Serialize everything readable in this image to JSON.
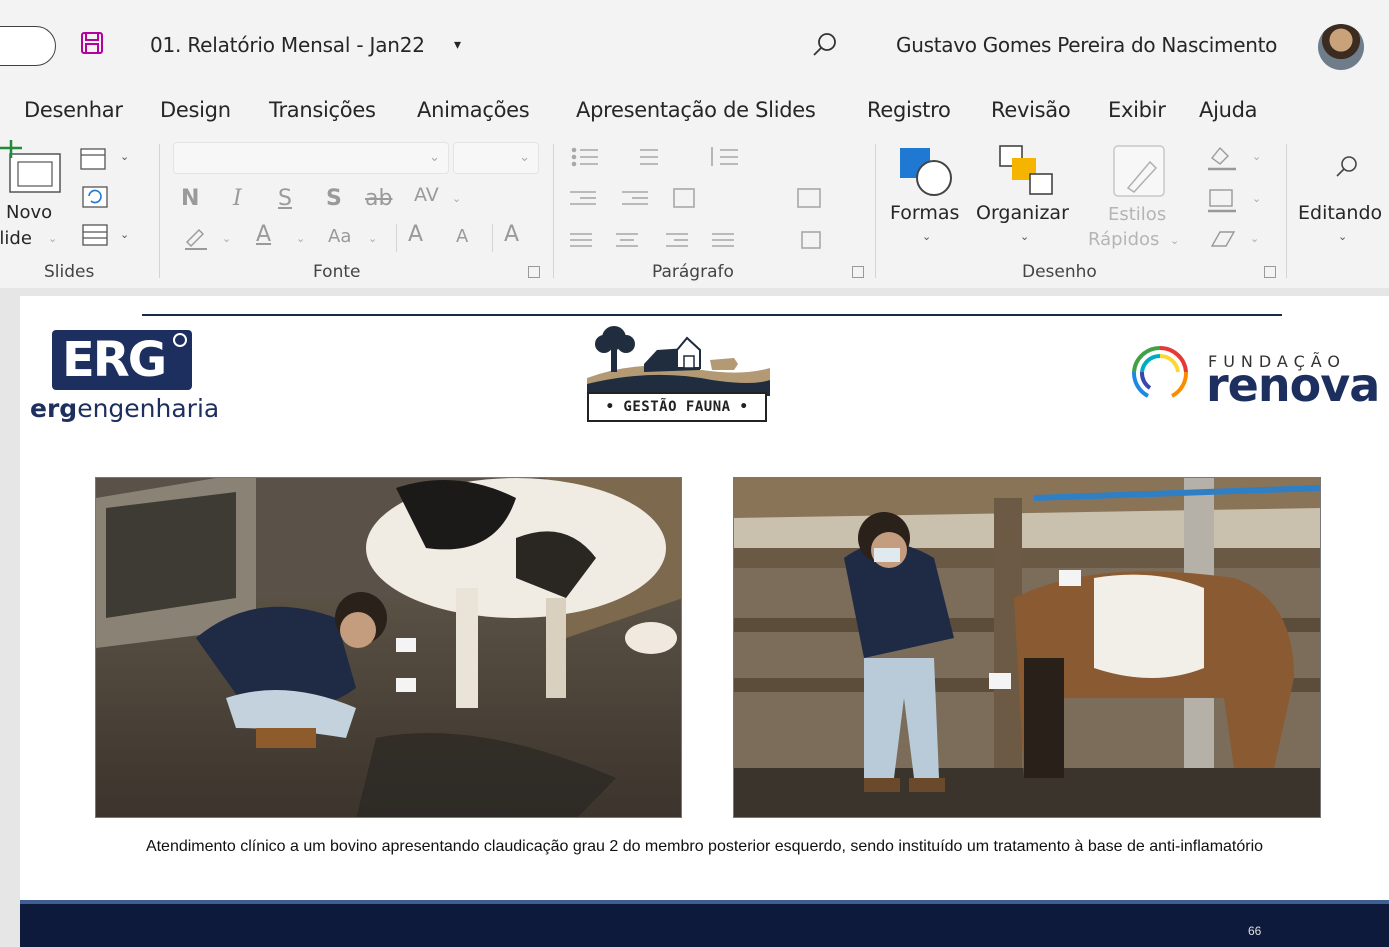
{
  "titlebar": {
    "doc_title": "01. Relatório Mensal - Jan22",
    "title_chevron": "▾",
    "user_name": "Gustavo Gomes Pereira do Nascimento",
    "save_icon_color": "#b4009e"
  },
  "tabs": [
    {
      "label": "Desenhar"
    },
    {
      "label": "Design"
    },
    {
      "label": "Transições"
    },
    {
      "label": "Animações"
    },
    {
      "label": "Apresentação de Slides"
    },
    {
      "label": "Registro"
    },
    {
      "label": "Revisão"
    },
    {
      "label": "Exibir"
    },
    {
      "label": "Ajuda"
    }
  ],
  "ribbon": {
    "slides": {
      "new_slide_line1": "Novo",
      "new_slide_line2": "Slide",
      "group_label": "Slides"
    },
    "font": {
      "bold": "N",
      "italic": "I",
      "underline": "S",
      "shadow": "S",
      "strikethrough": "ab",
      "spacing": "AV",
      "change_case": "Aa",
      "grow": "A",
      "shrink": "A",
      "group_label": "Fonte"
    },
    "paragraph": {
      "group_label": "Parágrafo"
    },
    "drawing": {
      "shapes_label": "Formas",
      "arrange_label": "Organizar",
      "quick_styles_line1": "Estilos",
      "quick_styles_line2": "Rápidos",
      "group_label": "Desenho"
    },
    "editing": {
      "label": "Editando"
    }
  },
  "slide": {
    "erg": {
      "box_text": "ERG",
      "sub_bold": "erg",
      "sub_rest": "engenharia"
    },
    "fauna": {
      "label": "• GESTÃO FAUNA •"
    },
    "renova": {
      "fundacao": "FUNDAÇÃO",
      "name": "renova"
    },
    "caption": "Atendimento clínico a um bovino apresentando claudicação grau 2 do membro posterior esquerdo, sendo instituído um tratamento à base de anti-inflamatório",
    "page_number": "66"
  },
  "colors": {
    "navy": "#1d2f5e",
    "footer": "#0e1a3c",
    "footer_accent": "#3f5f92",
    "shapes_blue": "#1f78d1",
    "arrange_orange": "#f4b400"
  }
}
